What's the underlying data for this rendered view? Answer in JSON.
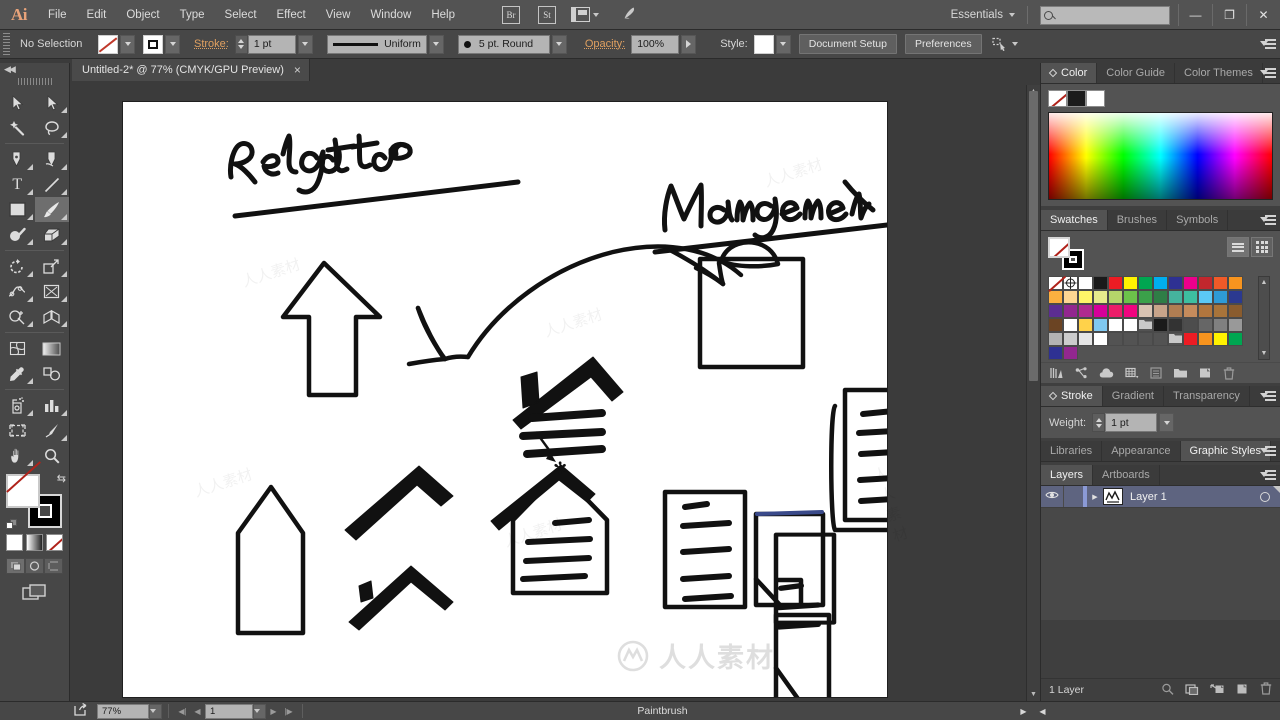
{
  "app": {
    "logo": "Ai",
    "menus": [
      "File",
      "Edit",
      "Object",
      "Type",
      "Select",
      "Effect",
      "View",
      "Window",
      "Help"
    ],
    "bridge_label": "Br",
    "stock_label": "St",
    "arrange_icon": "arrange-documents-icon",
    "stock_icon": "adobe-stock-icon",
    "workspace": "Essentials",
    "search_placeholder": "",
    "search_value": "",
    "window_minimize": "—",
    "window_restore": "❐",
    "window_close": "✕"
  },
  "control_bar": {
    "selection_status": "No Selection",
    "fill_swatch": "none",
    "stroke_swatch": "black",
    "stroke_label": "Stroke:",
    "stroke_weight": "1 pt",
    "stroke_profile": "Uniform",
    "brush_definition": "5 pt. Round",
    "opacity_label": "Opacity:",
    "opacity_value": "100%",
    "style_label": "Style:",
    "document_setup_label": "Document Setup",
    "preferences_label": "Preferences"
  },
  "document_tab": {
    "title": "Untitled-2* @ 77% (CMYK/GPU Preview)",
    "close": "×"
  },
  "tools": [
    {
      "name": "selection-tool",
      "glyph": "arrow"
    },
    {
      "name": "direct-selection-tool",
      "glyph": "arrow-white"
    },
    {
      "name": "magic-wand-tool",
      "glyph": "wand"
    },
    {
      "name": "lasso-tool",
      "glyph": "lasso"
    },
    {
      "name": "pen-tool",
      "glyph": "pen"
    },
    {
      "name": "curvature-tool",
      "glyph": "curvature"
    },
    {
      "name": "type-tool",
      "glyph": "T"
    },
    {
      "name": "line-segment-tool",
      "glyph": "line"
    },
    {
      "name": "rectangle-tool",
      "glyph": "rect"
    },
    {
      "name": "paintbrush-tool",
      "glyph": "brush",
      "active": true
    },
    {
      "name": "shaper-tool",
      "glyph": "shaper"
    },
    {
      "name": "eraser-tool",
      "glyph": "eraser"
    },
    {
      "name": "rotate-tool",
      "glyph": "rotate"
    },
    {
      "name": "scale-tool",
      "glyph": "scale"
    },
    {
      "name": "width-tool",
      "glyph": "width"
    },
    {
      "name": "free-transform-tool",
      "glyph": "transform"
    },
    {
      "name": "shape-builder-tool",
      "glyph": "shapebuilder"
    },
    {
      "name": "perspective-grid-tool",
      "glyph": "perspective"
    },
    {
      "name": "mesh-tool",
      "glyph": "mesh"
    },
    {
      "name": "gradient-tool",
      "glyph": "gradient"
    },
    {
      "name": "eyedropper-tool",
      "glyph": "eyedropper"
    },
    {
      "name": "blend-tool",
      "glyph": "blend"
    },
    {
      "name": "symbol-sprayer-tool",
      "glyph": "sprayer"
    },
    {
      "name": "column-graph-tool",
      "glyph": "graph"
    },
    {
      "name": "artboard-tool",
      "glyph": "artboard"
    },
    {
      "name": "slice-tool",
      "glyph": "slice"
    },
    {
      "name": "hand-tool",
      "glyph": "hand"
    },
    {
      "name": "zoom-tool",
      "glyph": "zoom"
    }
  ],
  "color_panel": {
    "tabs": [
      "Color",
      "Color Guide",
      "Color Themes"
    ],
    "active_tab": "Color"
  },
  "swatches_panel": {
    "tabs": [
      "Swatches",
      "Brushes",
      "Symbols"
    ],
    "active_tab": "Swatches",
    "swatch_colors": [
      "#ffffff",
      "#ffffff",
      "#ffffff",
      "#1a1a1a",
      "#ed1c24",
      "#fff200",
      "#00a651",
      "#00aeef",
      "#2e3192",
      "#ec008c",
      "#c1272d",
      "#f05a28",
      "#f7941e",
      "#fbb040",
      "#fdd692",
      "#fff568",
      "#e6ea8c",
      "#b5d56a",
      "#6cc24a",
      "#3ba14a",
      "#2f7d46",
      "#45b39d",
      "#3dbfa0",
      "#5bc8f5",
      "#2e9bd6",
      "#2b3990",
      "#5c2d91",
      "#92278f",
      "#b02a8f",
      "#d6009a",
      "#ec1d69",
      "#f0047f",
      "#d9c3b2",
      "#c8a48a",
      "#b07d52",
      "#c58b5c",
      "#b1763e",
      "#a8743a",
      "#8a5c2e",
      "#6b4423",
      "#ffffff",
      "#ffd24a",
      "#7fc8f0",
      "#ffffff",
      "#ffffff"
    ],
    "gray_row": [
      "#1a1a1a",
      "#333333",
      "#4d4d4d",
      "#666666",
      "#808080",
      "#999999",
      "#b3b3b3",
      "#cccccc",
      "#e6e6e6",
      "#ffffff"
    ],
    "bright_row": [
      "#ed1c24",
      "#f7941e",
      "#fff200",
      "#00a651",
      "#2e3192",
      "#92278f"
    ],
    "footer_icons": [
      "swatch-libraries-icon",
      "color-group-icon",
      "cc-library-icon",
      "show-swatch-kinds-icon",
      "swatch-options-icon",
      "new-color-group-icon",
      "new-swatch-icon",
      "delete-swatch-icon"
    ]
  },
  "stroke_panel": {
    "tabs": [
      "Stroke",
      "Gradient",
      "Transparency"
    ],
    "active_tab": "Stroke",
    "weight_label": "Weight:",
    "weight_value": "1 pt"
  },
  "styles_panel": {
    "tabs": [
      "Libraries",
      "Appearance",
      "Graphic Styles"
    ],
    "active_tab": "Graphic Styles"
  },
  "layers_panel": {
    "tabs": [
      "Layers",
      "Artboards"
    ],
    "active_tab": "Layers",
    "rows": [
      {
        "name": "Layer 1",
        "visible": true,
        "locked": false,
        "selected": true
      }
    ],
    "footer_count": "1 Layer",
    "footer_icons": [
      "locate-object-icon",
      "make-clipping-mask-icon",
      "create-new-sublayer-icon",
      "create-new-layer-icon",
      "delete-selection-icon"
    ]
  },
  "status_bar": {
    "zoom_value": "77%",
    "artboard_value": "1",
    "tool_status": "Paintbrush"
  },
  "artwork": {
    "title_text": "Real estate",
    "subtitle_text": "Management",
    "description": "hand-drawn sketch of houses, arrows, documents and a clipboard",
    "cursor": "paintbrush-cursor"
  },
  "watermarks": {
    "text": "人人素材",
    "brand": "人人素材"
  },
  "colors": {
    "chrome": "#474747",
    "panel": "#535353",
    "accent_orange": "#e0a060",
    "layer_selected": "#5e6480",
    "canvas_bg": "#3b3b3b",
    "artboard": "#ffffff"
  }
}
